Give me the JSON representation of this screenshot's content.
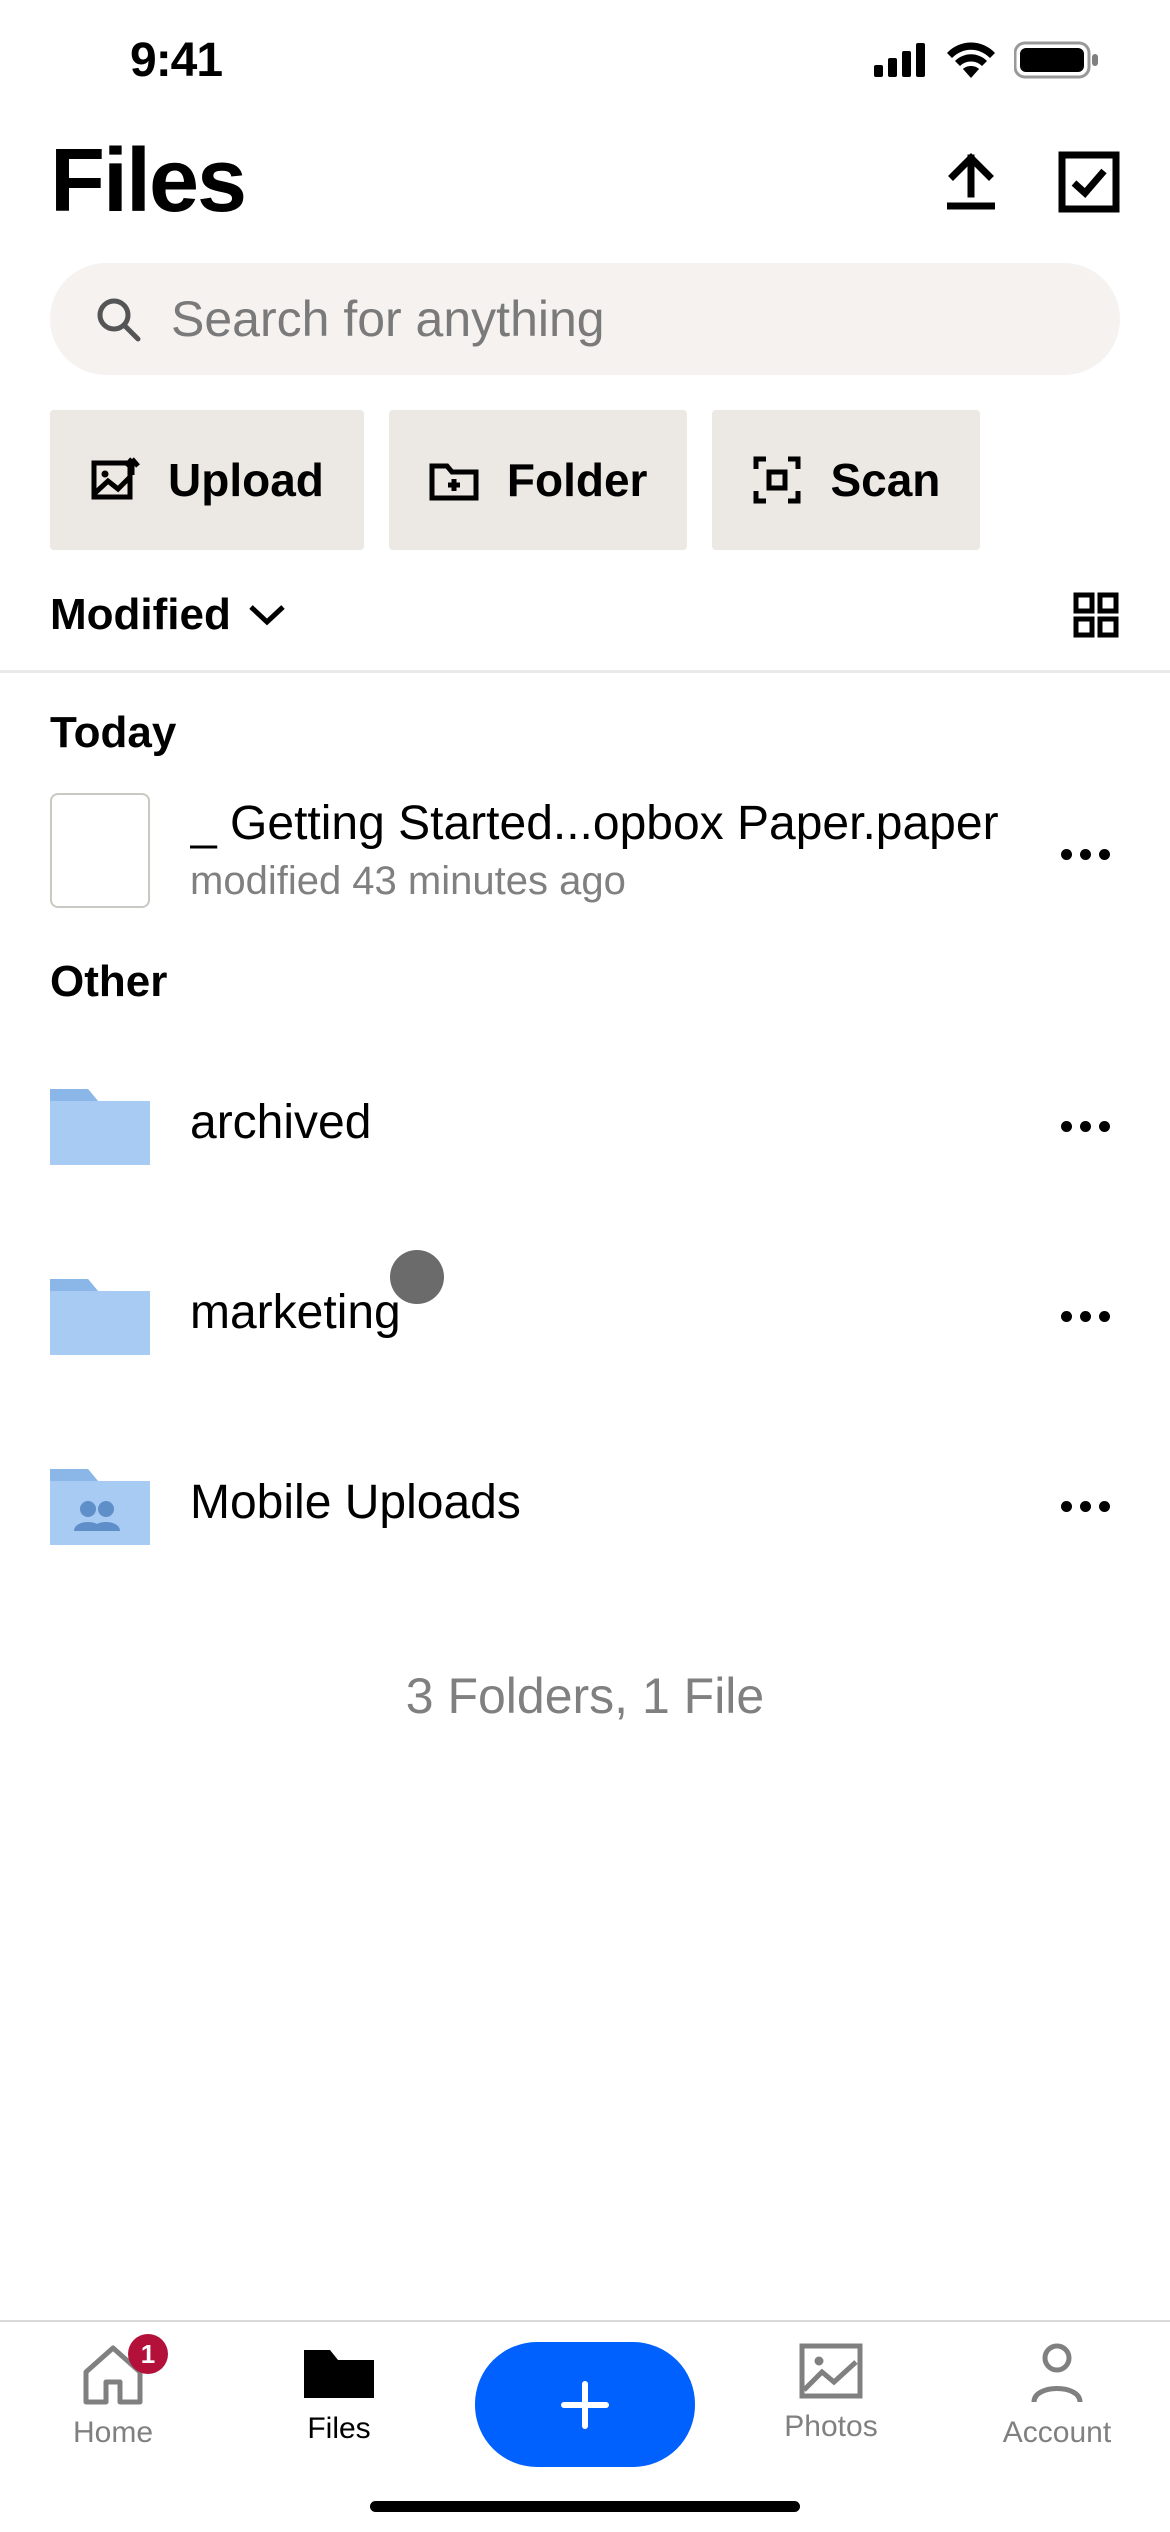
{
  "status": {
    "time": "9:41"
  },
  "header": {
    "title": "Files"
  },
  "search": {
    "placeholder": "Search for anything"
  },
  "actions": {
    "upload": "Upload",
    "folder": "Folder",
    "scan": "Scan"
  },
  "sort": {
    "label": "Modified"
  },
  "sections": {
    "today": "Today",
    "other": "Other"
  },
  "items": {
    "file1": {
      "name": "_ Getting Started...opbox Paper.paper",
      "subtitle": "modified 43 minutes ago"
    },
    "folder1": {
      "name": "archived"
    },
    "folder2": {
      "name": "marketing"
    },
    "folder3": {
      "name": "Mobile Uploads"
    }
  },
  "summary": "3 Folders, 1 File",
  "tabs": {
    "home": {
      "label": "Home",
      "badge": "1"
    },
    "files": {
      "label": "Files"
    },
    "photos": {
      "label": "Photos"
    },
    "account": {
      "label": "Account"
    }
  },
  "colors": {
    "accent": "#0061fe",
    "folder": "#a8cbf3",
    "badge": "#b3103a"
  }
}
